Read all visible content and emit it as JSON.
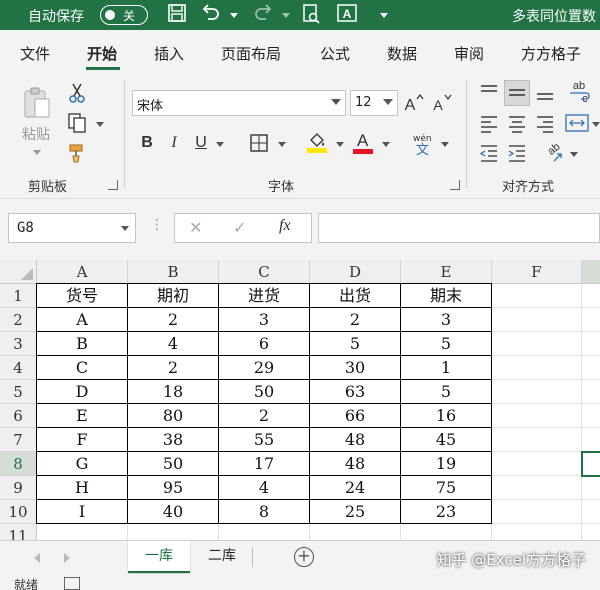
{
  "titlebar": {
    "autosave_label": "自动保存",
    "autosave_state": "关",
    "doc_title": "多表同位置数",
    "icons": [
      "save-icon",
      "undo-icon",
      "redo-icon",
      "print-preview-icon",
      "text-box-icon"
    ]
  },
  "menu": {
    "tabs": [
      "文件",
      "开始",
      "插入",
      "页面布局",
      "公式",
      "数据",
      "审阅",
      "方方格子"
    ],
    "active": "开始"
  },
  "ribbon": {
    "clipboard": {
      "paste_label": "粘贴",
      "group_label": "剪贴板"
    },
    "font": {
      "font_name": "宋体",
      "font_size": "12",
      "bold": "B",
      "italic": "I",
      "underline": "U",
      "font_color_letter": "A",
      "phonetic_top": "wén",
      "phonetic_bottom": "文",
      "group_label": "字体",
      "highlight_color": "#FFE600",
      "font_color": "#E81123"
    },
    "alignment": {
      "group_label": "对齐方式",
      "wrap_icon_text": "ab c"
    }
  },
  "formula_bar": {
    "name_box": "G8",
    "cancel": "✕",
    "confirm": "✓",
    "fx": "fx",
    "formula": ""
  },
  "grid": {
    "columns": [
      "A",
      "B",
      "C",
      "D",
      "E",
      "F"
    ],
    "row_numbers": [
      "1",
      "2",
      "3",
      "4",
      "5",
      "6",
      "7",
      "8",
      "9",
      "10",
      "11"
    ],
    "selected_cell": "G8",
    "rows": [
      [
        "货号",
        "期初",
        "进货",
        "出货",
        "期末"
      ],
      [
        "A",
        "2",
        "3",
        "2",
        "3"
      ],
      [
        "B",
        "4",
        "6",
        "5",
        "5"
      ],
      [
        "C",
        "2",
        "29",
        "30",
        "1"
      ],
      [
        "D",
        "18",
        "50",
        "63",
        "5"
      ],
      [
        "E",
        "80",
        "2",
        "66",
        "16"
      ],
      [
        "F",
        "38",
        "55",
        "48",
        "45"
      ],
      [
        "G",
        "50",
        "17",
        "48",
        "19"
      ],
      [
        "H",
        "95",
        "4",
        "24",
        "75"
      ],
      [
        "I",
        "40",
        "8",
        "25",
        "23"
      ]
    ]
  },
  "sheets": {
    "tabs": [
      "一库",
      "二库"
    ],
    "active": "一库",
    "add": "+"
  },
  "watermark": "知乎 @Excel方方格子",
  "status": {
    "text": "就绪"
  },
  "colors": {
    "accent": "#217346"
  }
}
